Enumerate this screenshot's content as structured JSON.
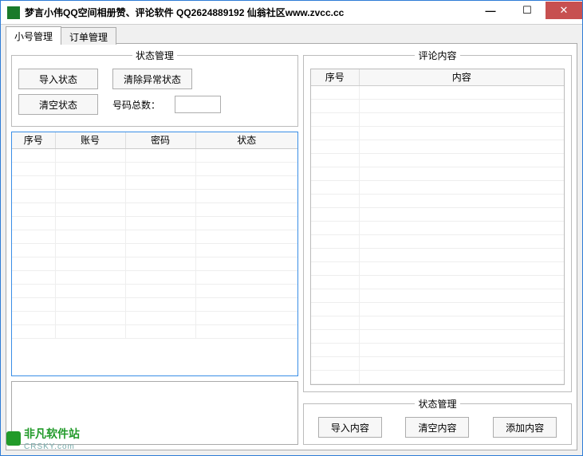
{
  "title": "梦言小伟QQ空间相册赞、评论软件   QQ2624889192    仙翁社区www.zvcc.cc",
  "tabs": {
    "account": "小号管理",
    "order": "订单管理"
  },
  "left": {
    "state_group": "状态管理",
    "import_state": "导入状态",
    "clear_abnormal": "清除异常状态",
    "empty_state": "清空状态",
    "count_label": "号码总数：",
    "count_value": "",
    "headers": {
      "idx": "序号",
      "acc": "账号",
      "pwd": "密码",
      "stat": "状态"
    }
  },
  "right": {
    "content_group": "评论内容",
    "headers": {
      "idx": "序号",
      "content": "内容"
    },
    "action_group": "状态管理",
    "import_content": "导入内容",
    "empty_content": "清空内容",
    "add_content": "添加内容"
  },
  "watermark": {
    "cn": "非凡软件站",
    "en": "CRSKY.com"
  },
  "win": {
    "min": "—",
    "max": "☐",
    "close": "✕"
  }
}
